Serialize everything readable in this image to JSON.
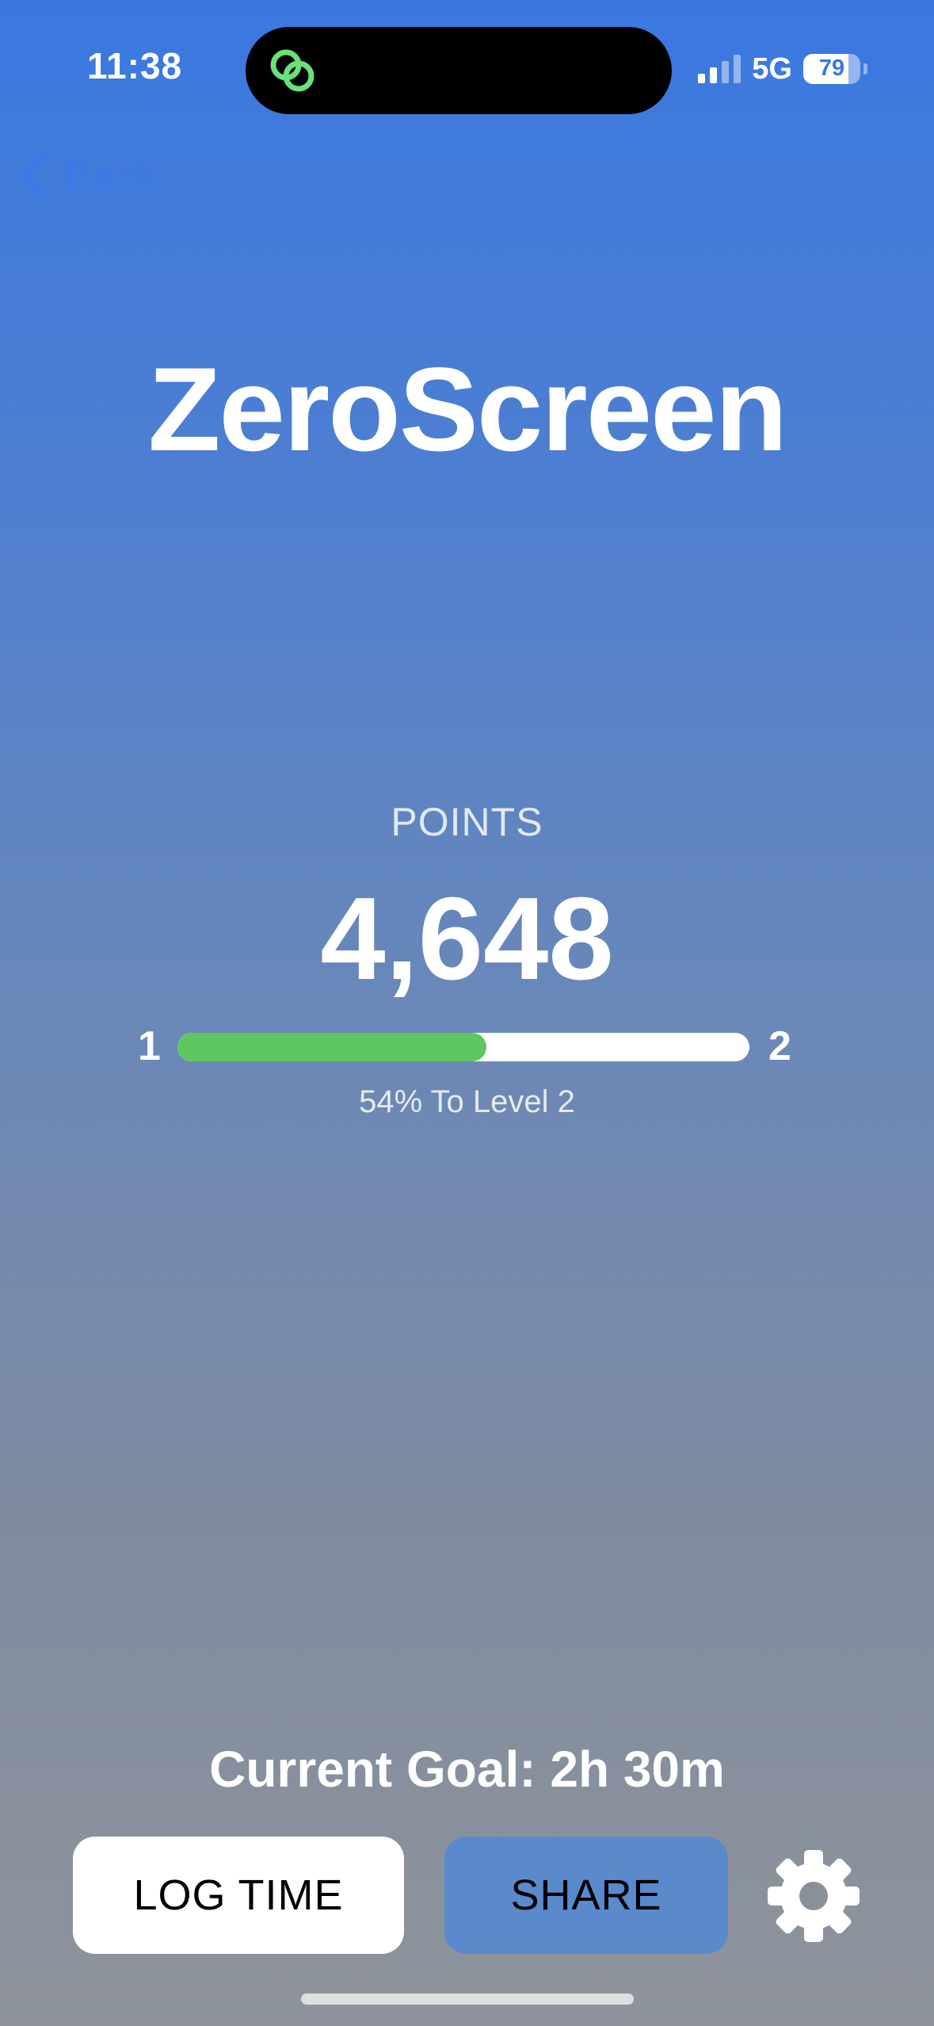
{
  "status_bar": {
    "time": "11:38",
    "network": "5G",
    "battery": "79",
    "battery_level": 0.79,
    "signal_bars_active": 2,
    "signal_bars_total": 4
  },
  "nav": {
    "back_label": "Back"
  },
  "app": {
    "title": "ZeroScreen"
  },
  "points": {
    "label": "POINTS",
    "value": "4,648"
  },
  "progress": {
    "from_level": "1",
    "to_level": "2",
    "percent": 54,
    "text": "54% To Level 2",
    "fill_color": "#5fc760",
    "track_color": "#ffffff"
  },
  "goal": {
    "text": "Current Goal: 2h 30m"
  },
  "actions": {
    "log_time_label": "LOG TIME",
    "share_label": "SHARE"
  },
  "icons": {
    "island": "linked-rings-icon",
    "back": "chevron-left-icon",
    "settings": "gear-icon"
  },
  "colors": {
    "gradient_top": "#3a78e0",
    "gradient_bottom": "#8f949b",
    "share_button": "#5a89cc",
    "back_link": "#3b79e8",
    "island_icon": "#69e07a"
  }
}
